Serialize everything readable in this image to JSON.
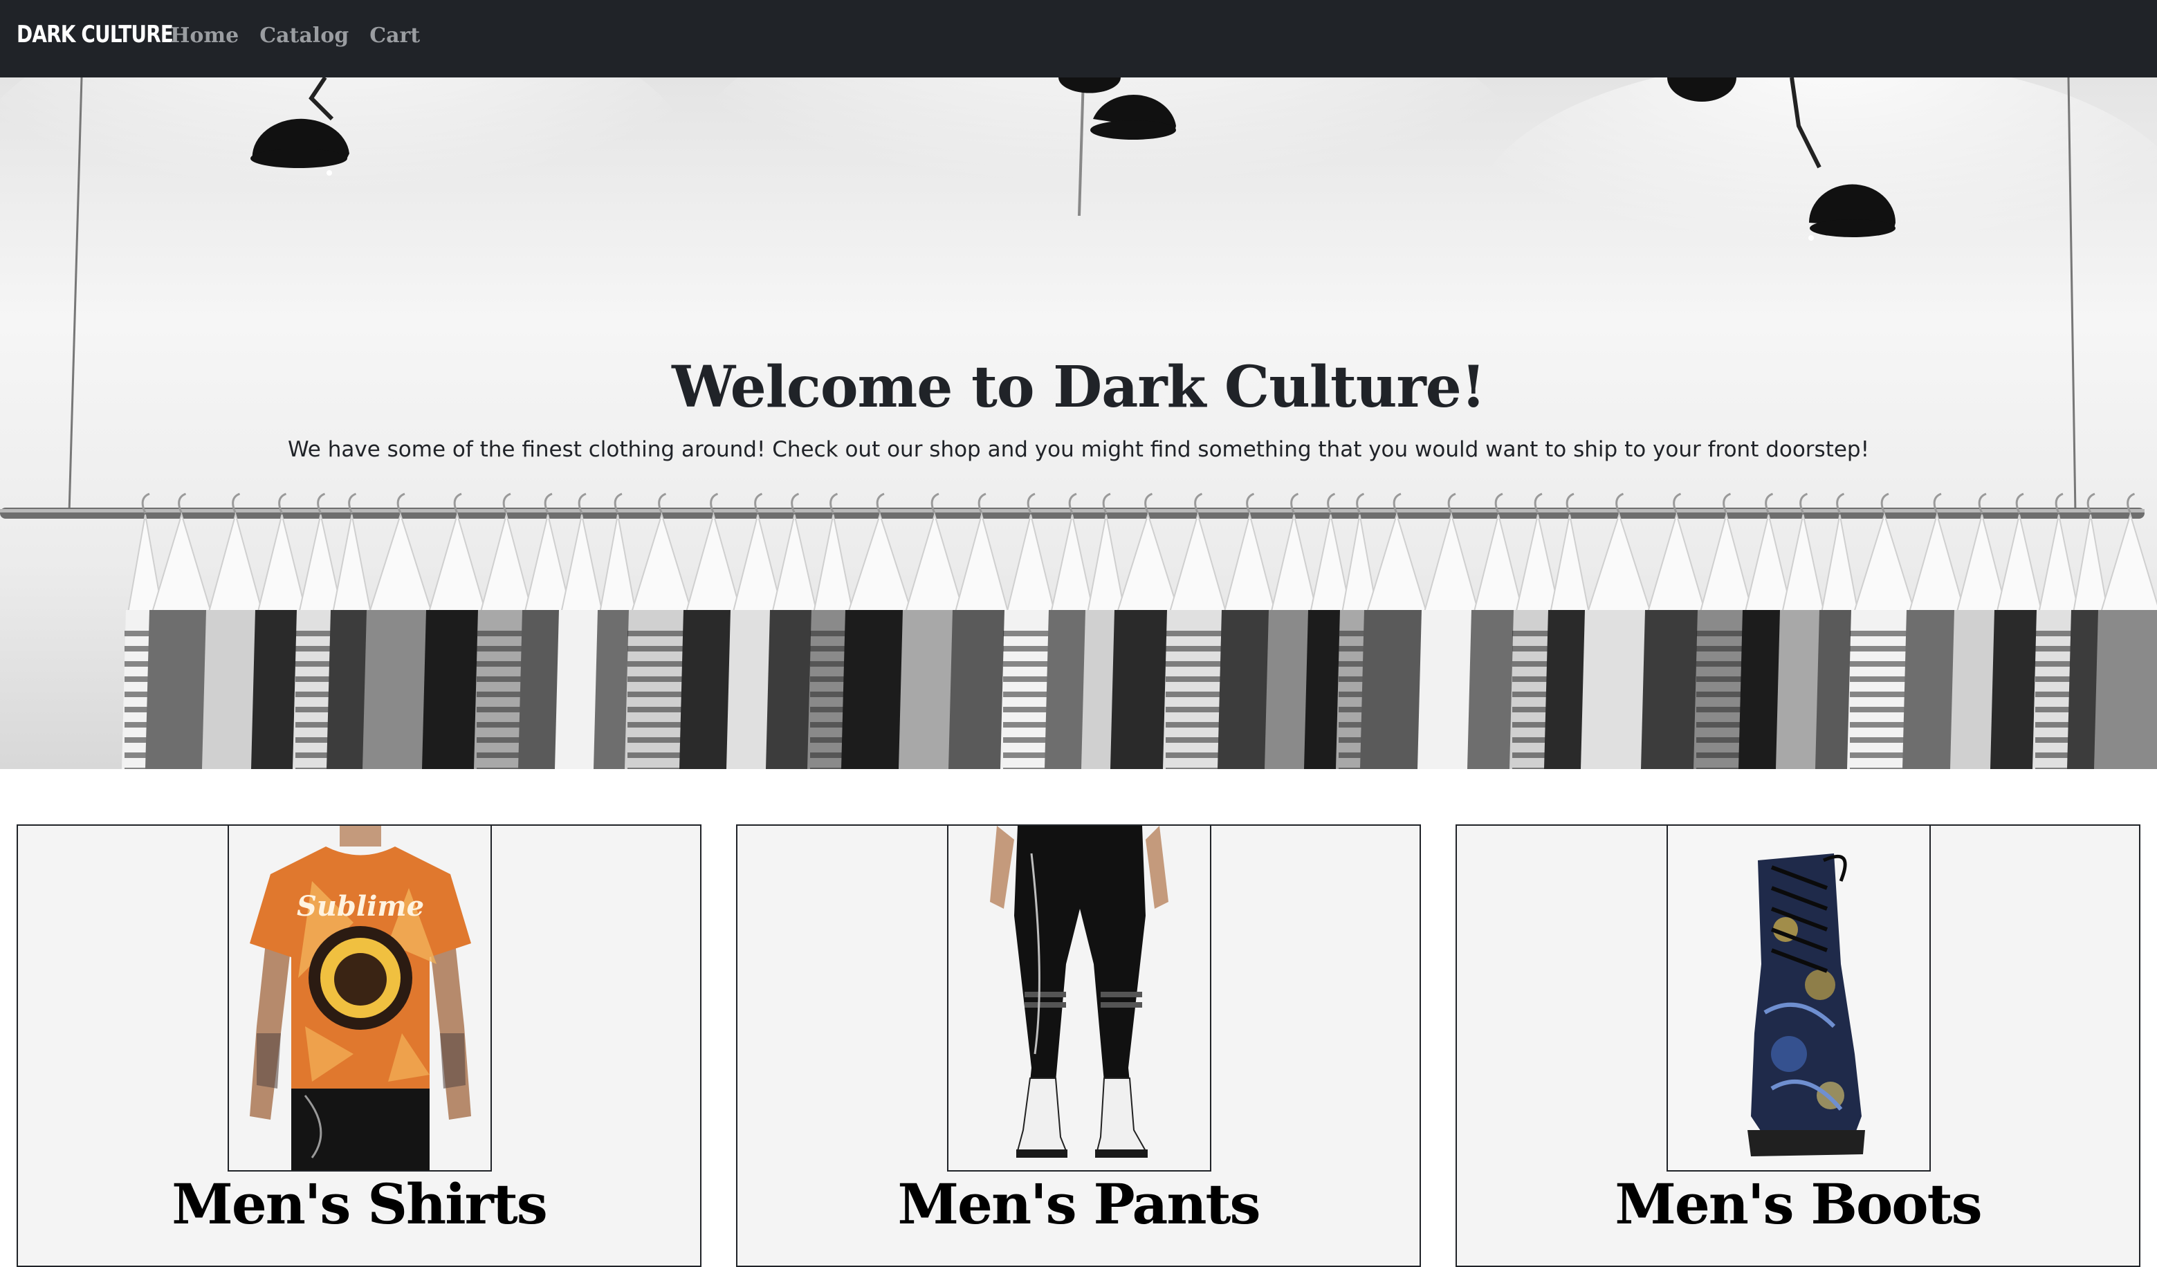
{
  "navbar": {
    "brand": "DARK CULTURE",
    "links": [
      "Home",
      "Catalog",
      "Cart"
    ]
  },
  "hero": {
    "title": "Welcome to Dark Culture!",
    "subtitle": "We have some of the finest clothing around! Check out our shop and you might find something that you would want to ship to your front doorstep!",
    "image": "clothing-rack-photo"
  },
  "categories": [
    {
      "title": "Men's Shirts",
      "image": "sublime-tie-dye-tshirt"
    },
    {
      "title": "Men's Pants",
      "image": "black-skinny-jeans-with-chain"
    },
    {
      "title": "Men's Boots",
      "image": "starry-night-combat-boot"
    }
  ],
  "colors": {
    "navbar_bg": "#202328",
    "nav_link": "#9a9da1",
    "text_dark": "#202328",
    "card_bg": "#f4f4f4"
  }
}
